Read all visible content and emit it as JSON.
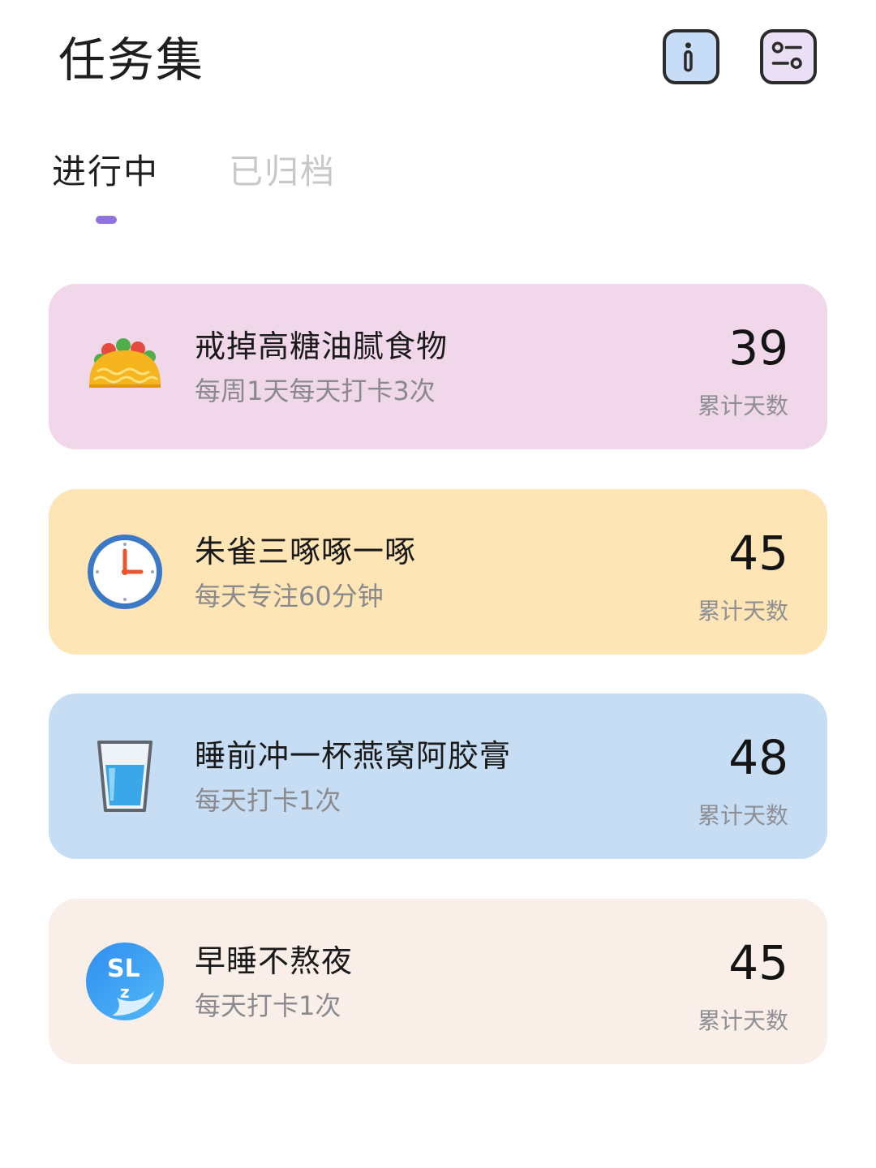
{
  "header": {
    "title": "任务集",
    "info_icon": "info-icon",
    "settings_icon": "toggle-settings-icon"
  },
  "tabs": [
    {
      "label": "进行中",
      "active": true
    },
    {
      "label": "已归档",
      "active": false
    }
  ],
  "colors": {
    "accent": "#8f74e0",
    "card_pink": "#f0d7ea",
    "card_yellow": "#fde5b6",
    "card_blue": "#c6ddf4",
    "card_cream": "#faeee9"
  },
  "tasks": [
    {
      "icon": "taco-icon",
      "name": "戒掉高糖油腻食物",
      "frequency": "每周1天每天打卡3次",
      "count": "39",
      "count_label": "累计天数",
      "bg": "#f0d7ea"
    },
    {
      "icon": "clock-icon",
      "name": "朱雀三啄啄一啄",
      "frequency": "每天专注60分钟",
      "count": "45",
      "count_label": "累计天数",
      "bg": "#fde5b6"
    },
    {
      "icon": "water-glass-icon",
      "name": "睡前冲一杯燕窝阿胶膏",
      "frequency": "每天打卡1次",
      "count": "48",
      "count_label": "累计天数",
      "bg": "#c6ddf4"
    },
    {
      "icon": "sleep-moon-icon",
      "name": "早睡不熬夜",
      "frequency": "每天打卡1次",
      "count": "45",
      "count_label": "累计天数",
      "bg": "#faeee9",
      "icon_text": "SL",
      "icon_subtext": "z"
    }
  ]
}
